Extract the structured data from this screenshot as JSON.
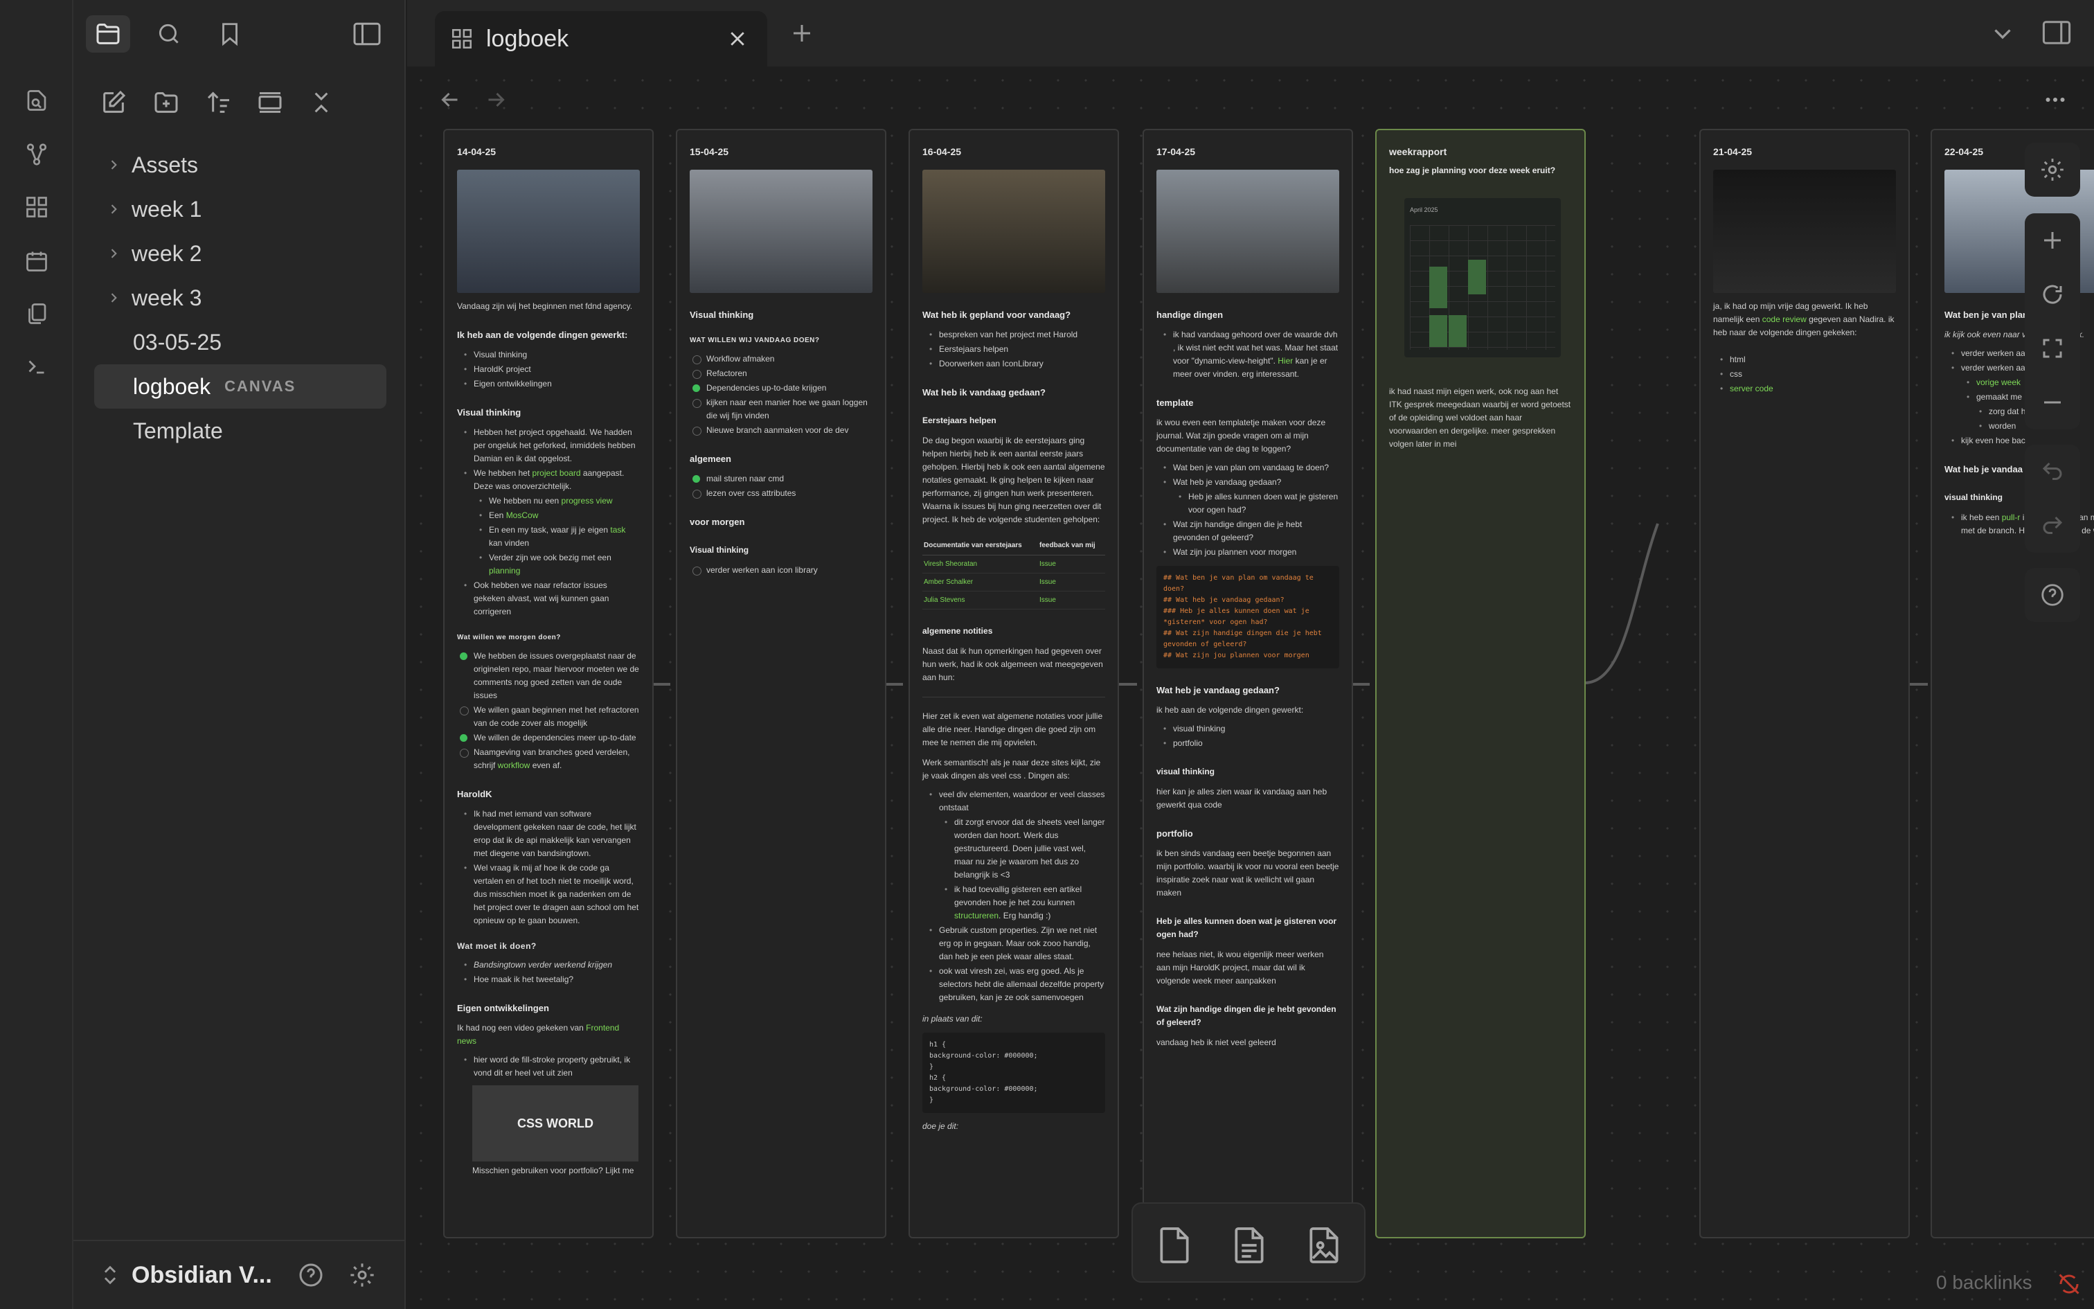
{
  "app": {
    "vault_name": "Obsidian V..."
  },
  "sidebar": {
    "items": [
      {
        "label": "Assets",
        "type": "folder"
      },
      {
        "label": "week 1",
        "type": "folder"
      },
      {
        "label": "week 2",
        "type": "folder"
      },
      {
        "label": "week 3",
        "type": "folder"
      },
      {
        "label": "03-05-25",
        "type": "file"
      },
      {
        "label": "logboek",
        "type": "file",
        "badge": "CANVAS",
        "selected": true
      },
      {
        "label": "Template",
        "type": "file"
      }
    ]
  },
  "tab": {
    "title": "logboek"
  },
  "backlinks": "0 backlinks",
  "accent_color": "#7ed957",
  "cards": {
    "c1": {
      "date": "14-04-25",
      "intro": "Vandaag zijn wij het beginnen met fdnd agency.",
      "h_worked": "Ik heb aan de volgende dingen gewerkt:",
      "worked": [
        "Visual thinking",
        "HaroldK project",
        "Eigen ontwikkelingen"
      ],
      "h_vt": "Visual thinking",
      "vt1": "Hebben het project opgehaald. We hadden per ongeluk het geforked, inmiddels hebben Damian en ik dat opgelost.",
      "vt2_a": "We hebben het ",
      "vt2_link": "project board",
      "vt2_b": " aangepast. Deze was onoverzichtelijk.",
      "vt3_a": "We hebben nu een ",
      "vt3_link": "progress view",
      "vt4_a": "Een ",
      "vt4_link": "MosCow",
      "vt5_a": "En een my task, waar jij je eigen ",
      "vt5_link": "task",
      "vt5_b": " kan vinden",
      "vt6_a": "Verder zijn we ook bezig met een ",
      "vt6_link": "planning",
      "vt7": "Ook hebben we naar refactor issues gekeken alvast, wat wij kunnen gaan corrigeren",
      "h_tomorrow": "Wat willen we morgen doen?",
      "tm1": "We hebben de issues overgeplaatst naar de originelen repo, maar hiervoor moeten we de comments nog goed zetten van de oude issues",
      "tm2": "We willen gaan beginnen met het refractoren van de code zover als mogelijk",
      "tm3": "We willen de dependencies meer up-to-date",
      "tm4_a": "Naamgeving van branches goed verdelen, schrijf ",
      "tm4_link": "workflow",
      "tm4_b": " even af.",
      "h_harold": "HaroldK",
      "hk1": "Ik had met iemand van software development gekeken naar de code, het lijkt erop dat ik de api makkelijk kan vervangen met diegene van bandsingtown.",
      "hk2": "Wel vraag ik mij af hoe ik de code ga vertalen en of het toch niet te moeilijk word, dus misschien moet ik ga nadenken om de het project over te dragen aan school om het opnieuw op te gaan bouwen.",
      "h_todo": "Wat moet ik doen?",
      "todo1": "Bandsingtown verder werkend krijgen",
      "todo2": "Hoe maak ik het tweetalig?",
      "h_eigen": "Eigen ontwikkelingen",
      "eo1_a": "Ik had nog een video gekeken van ",
      "eo1_link": "Frontend news",
      "eo2": "hier word de fill-stroke property gebruikt, ik vond dit er heel vet uit zien",
      "thumb_text": "CSS WORLD",
      "eo3": "Misschien gebruiken voor portfolio? Lijkt me"
    },
    "c2": {
      "date": "15-04-25",
      "h_vt": "Visual thinking",
      "sub": "WAT WILLEN WIJ VANDAAG DOEN?",
      "todo": [
        "Workflow afmaken",
        "Refactoren",
        "Dependencies up-to-date krijgen",
        "kijken naar een manier hoe we gaan loggen die wij fijn vinden",
        "Nieuwe branch aanmaken voor de dev"
      ],
      "h_alg": "algemeen",
      "alg": [
        "mail sturen naar cmd",
        "lezen over css attributes"
      ],
      "h_morgen": "voor morgen",
      "h_vt2": "Visual thinking",
      "vt2": [
        "verder werken aan icon library"
      ]
    },
    "c3": {
      "date": "16-04-25",
      "h_plan": "Wat heb ik gepland voor vandaag?",
      "plan": [
        "bespreken van het project met Harold",
        "Eerstejaars helpen",
        "Doorwerken aan IconLibrary"
      ],
      "h_done": "Wat heb ik vandaag gedaan?",
      "h_eerst": "Eerstejaars helpen",
      "p1": "De dag begon waarbij ik de eerstejaars ging helpen hierbij heb ik een aantal eerste jaars geholpen. Hierbij heb ik ook een aantal algemene notaties gemaakt. Ik ging helpen te kijken naar performance, zij gingen hun werk presenteren. Waarna ik issues bij hun ging neerzetten over dit project. Ik heb de volgende studenten geholpen:",
      "th1": "Documentatie van eerstejaars",
      "th2": "feedback van mij",
      "rows": [
        [
          "Viresh Sheoratan",
          "Issue"
        ],
        [
          "Amber Schalker",
          "Issue"
        ],
        [
          "Julia Stevens",
          "Issue"
        ]
      ],
      "h_notes": "algemene notities",
      "p2": "Naast dat ik hun opmerkingen had gegeven over hun werk, had ik ook algemeen wat meegegeven aan hun:",
      "p3": "Hier zet ik even wat algemene notaties voor jullie alle drie neer. Handige dingen die goed zijn om mee te nemen die mij opvielen.",
      "p4": "Werk semantisch! als je naar deze sites kijkt, zie je vaak dingen als veel css . Dingen als:",
      "n1": "veel div elementen, waardoor er veel classes ontstaat",
      "n2": "dit zorgt ervoor dat de sheets veel langer worden dan hoort. Werk dus gestructureerd. Doen jullie vast wel, maar nu zie je waarom het dus zo belangrijk is <3",
      "n3_a": "ik had toevallig gisteren een artikel gevonden hoe je het zou kunnen ",
      "n3_link": "structureren",
      "n3_b": ". Erg handig :)",
      "n4": "Gebruik custom properties. Zijn we net niet erg op in gegaan. Maar ook zooo handig, dan heb je een plek waar alles staat.",
      "n5": "ook wat viresh zei, was erg goed. Als je selectors hebt die allemaal dezelfde property gebruiken, kan je ze ook samenvoegen",
      "p5": "in plaats van dit:",
      "code": [
        "h1 {",
        "background-color: #000000;",
        "}",
        "h2 {",
        "background-color: #000000;",
        "}"
      ],
      "p6": "doe je dit:"
    },
    "c4": {
      "date": "17-04-25",
      "h_handig": "handige dingen",
      "hd1_a": "ik had vandaag gehoord over de waarde dvh , ik wist niet echt wat het was. Maar het staat voor \"dynamic-view-height\". ",
      "hd1_link": "Hier",
      "hd1_b": " kan je er meer over vinden. erg interessant.",
      "h_tpl": "template",
      "tp1": "ik wou even een templatetje maken voor deze journal. Wat zijn goede vragen om al mijn documentatie van de dag te loggen?",
      "q": [
        "Wat ben je van plan om vandaag te doen?",
        "Wat heb je vandaag gedaan?",
        "Heb je alles kunnen doen wat je gisteren voor ogen had?",
        "Wat zijn handige dingen die je hebt gevonden of geleerd?",
        "Wat zijn jou plannen voor morgen"
      ],
      "code": [
        "## Wat ben je van plan om vandaag te doen?",
        "## Wat heb je vandaag gedaan?",
        "###  Heb je alles kunnen doen wat je *gisteren* voor ogen had?",
        "## Wat zijn handige dingen die je hebt gevonden of geleerd?",
        "## Wat zijn jou plannen voor morgen"
      ],
      "h_done": "Wat heb je vandaag gedaan?",
      "d1": "ik heb aan de volgende dingen gewerkt:",
      "done": [
        "visual thinking",
        "portfolio"
      ],
      "h_vt": "visual thinking",
      "vt": "hier kan je alles zien waar ik vandaag aan heb gewerkt qua code",
      "h_pf": "portfolio",
      "pf": "ik ben sinds vandaag een beetje begonnen aan mijn portfolio. waarbij ik voor nu vooral een beetje inspiratie zoek naar wat ik wellicht wil gaan maken",
      "h_all": "Heb je alles kunnen doen wat je gisteren voor ogen had?",
      "all": "nee helaas niet, ik wou eigenlijk meer werken aan mijn HaroldK project, maar dat wil ik volgende week meer aanpakken",
      "h_learn": "Wat zijn handige dingen die je hebt gevonden of geleerd?",
      "learn": "vandaag heb ik niet veel geleerd"
    },
    "c5": {
      "title": "weekrapport",
      "q": "hoe zag je planning voor deze week eruit?",
      "cal_month": "April 2025",
      "p": "ik had naast mijn eigen werk, ook nog aan het ITK gesprek meegedaan waarbij er word getoetst of de opleiding wel voldoet aan haar voorwaarden en dergelijke. meer gesprekken volgen later in mei"
    },
    "c6": {
      "date": "21-04-25",
      "p_a": "ja, ik had op mijn vrije dag gewerkt. Ik heb namelijk een ",
      "p_link": "code review",
      "p_b": " gegeven aan Nadira. ik heb naar de volgende dingen gekeken:",
      "list": [
        "html",
        "css",
        "server code"
      ]
    },
    "c7": {
      "date": "22-04-25",
      "h1": "Wat ben je van plan",
      "p1": "ik kijk ook even naar van vorige week.",
      "l1": "verder werken aan",
      "l2": "verder werken aan",
      "l3": "vorige week",
      "l4": "gemaakt me",
      "l5": "zorg dat hier ook issues",
      "l6": "worden",
      "l7": "kijk even hoe bac",
      "h2": "Wat heb je vandaa",
      "h3": "visual thinking",
      "p2_a": "ik heb een ",
      "p2_link": "pull-r",
      "p2_b": " ik een branch van mi merch met de branch. Hierbij librar aan de website"
    }
  }
}
